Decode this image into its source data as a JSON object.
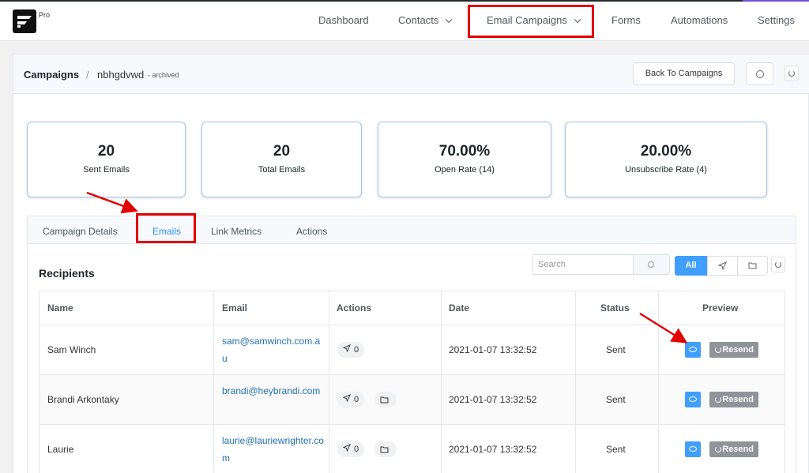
{
  "brand": {
    "badge": "Pro"
  },
  "nav": {
    "items": [
      {
        "label": "Dashboard"
      },
      {
        "label": "Contacts"
      },
      {
        "label": "Email Campaigns"
      },
      {
        "label": "Forms"
      },
      {
        "label": "Automations"
      },
      {
        "label": "Settings"
      }
    ]
  },
  "header": {
    "breadcrumb_root": "Campaigns",
    "separator": "/",
    "campaign_name": "nbhgdvwd",
    "status": "- archived",
    "back_button": "Back To Campaigns"
  },
  "stats": [
    {
      "value": "20",
      "label": "Sent Emails"
    },
    {
      "value": "20",
      "label": "Total Emails"
    },
    {
      "value": "70.00%",
      "label": "Open Rate (14)"
    },
    {
      "value": "20.00%",
      "label": "Unsubscribe Rate (4)"
    }
  ],
  "tabs": [
    {
      "label": "Campaign Details"
    },
    {
      "label": "Emails"
    },
    {
      "label": "Link Metrics"
    },
    {
      "label": "Actions"
    }
  ],
  "recipients": {
    "title": "Recipients",
    "search_placeholder": "Search",
    "filter_all": "All",
    "columns": [
      "Name",
      "Email",
      "Actions",
      "Date",
      "Status",
      "Preview"
    ],
    "rows": [
      {
        "name": "Sam Winch",
        "email": "sam@samwinch.com.au",
        "clicks": "0",
        "date": "2021-01-07 13:32:52",
        "status": "Sent",
        "resend": "Resend"
      },
      {
        "name": "Brandi Arkontaky",
        "email": "brandi@heybrandi.com",
        "clicks": "0",
        "date": "2021-01-07 13:32:52",
        "status": "Sent",
        "resend": "Resend"
      },
      {
        "name": "Laurie",
        "email": "laurie@lauriewrighter.com",
        "clicks": "0",
        "date": "2021-01-07 13:32:52",
        "status": "Sent",
        "resend": "Resend"
      }
    ]
  },
  "colors": {
    "accent": "#409eff",
    "highlight": "#e10000"
  }
}
